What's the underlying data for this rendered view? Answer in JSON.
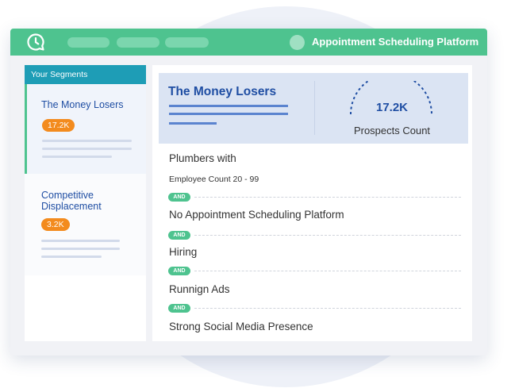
{
  "app": {
    "title": "Appointment Scheduling Platform"
  },
  "sidebar": {
    "header": "Your Segments",
    "segments": [
      {
        "name": "The Money Losers",
        "count": "17.2K"
      },
      {
        "name": "Competitive Displacement",
        "count": "3.2K"
      }
    ]
  },
  "segment_card": {
    "title": "The Money Losers",
    "prospects_count": "17.2K",
    "prospects_label": "Prospects Count"
  },
  "criteria": [
    "Plumbers with",
    "Employee Count 20 - 99",
    "No  Appointment Scheduling Platform",
    "Hiring",
    "Runnign Ads",
    "Strong Social Media Presence"
  ],
  "and_label": "AND",
  "colors": {
    "brand_green": "#4ec38f",
    "accent_teal": "#1e9db6",
    "badge_orange": "#f38b1e",
    "title_blue": "#1f4ea3"
  },
  "icons": {
    "logo": "chat-bubble-clock-icon",
    "avatar": "user-avatar"
  }
}
